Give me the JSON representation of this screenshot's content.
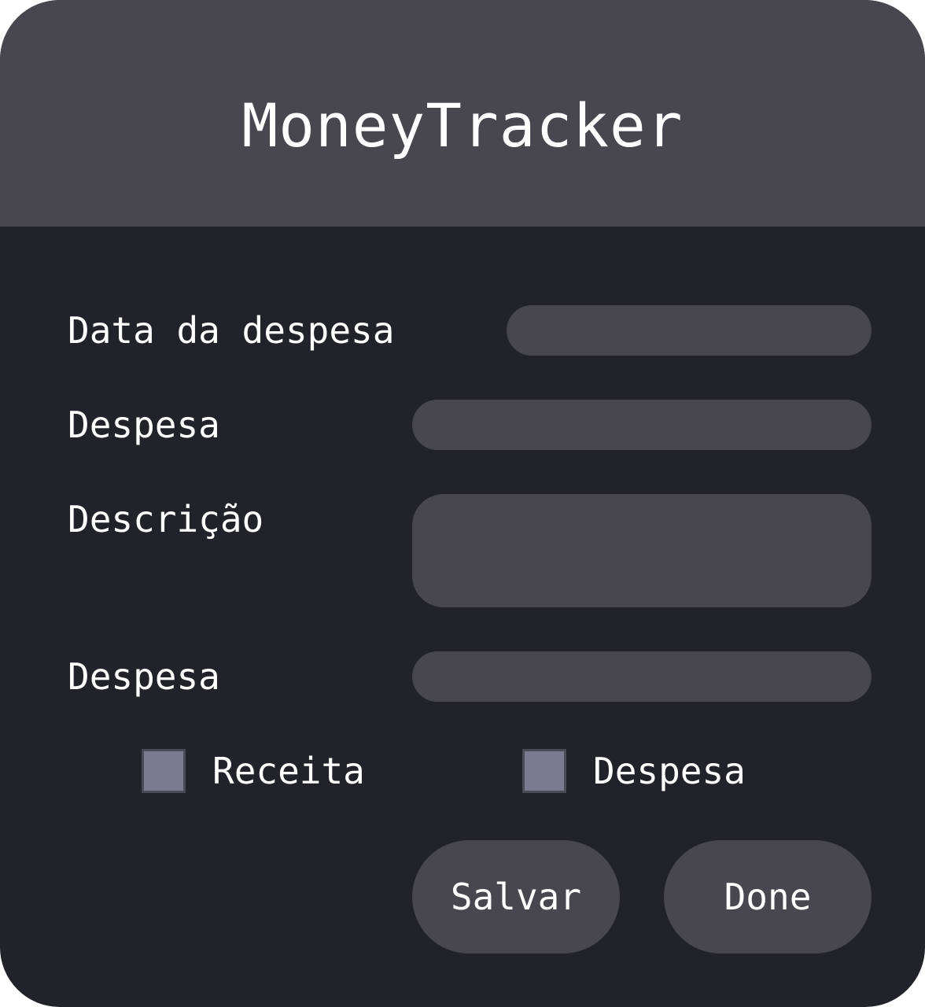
{
  "app": {
    "title": "MoneyTracker"
  },
  "form": {
    "date_label": "Data da despesa",
    "amount_label": "Despesa",
    "description_label": "Descrição",
    "category_label": "Despesa"
  },
  "type_options": {
    "income_label": "Receita",
    "expense_label": "Despesa",
    "income_checked": false,
    "expense_checked": false
  },
  "actions": {
    "save_label": "Salvar",
    "done_label": "Done"
  },
  "colors": {
    "header_bg": "#484750",
    "body_bg": "#22222b",
    "field_bg": "#484750",
    "checkbox_bg": "#7a7a90",
    "text": "#ffffff"
  }
}
